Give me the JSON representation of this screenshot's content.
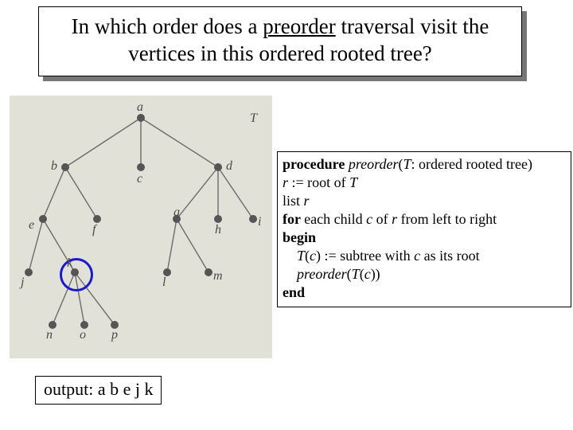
{
  "title": {
    "pre": "In which order does a ",
    "underlined": "preorder",
    "post": " traversal visit the vertices in this ordered rooted tree?"
  },
  "tree": {
    "label_T": "T",
    "nodes": {
      "a": "a",
      "b": "b",
      "c": "c",
      "d": "d",
      "e": "e",
      "f": "f",
      "g": "g",
      "h": "h",
      "i": "i",
      "j": "j",
      "k": "k",
      "l": "l",
      "m": "m",
      "n": "n",
      "o": "o",
      "p": "p"
    }
  },
  "algo": {
    "l1_b": "procedure ",
    "l1_i": "preorder",
    "l1_rest_a": "(",
    "l1_T": "T",
    "l1_rest_b": ": ordered rooted tree)",
    "l2_a": "r",
    "l2_b": " := root of ",
    "l2_c": "T",
    "l3_a": "list ",
    "l3_b": "r",
    "l4_a": "for ",
    "l4_b": "each child ",
    "l4_c": "c",
    "l4_d": " of ",
    "l4_e": "r",
    "l4_f": " from left to right",
    "l5": "begin",
    "l6_a": "T",
    "l6_b": "(",
    "l6_c": "c",
    "l6_d": ") := subtree with ",
    "l6_e": "c",
    "l6_f": " as its root",
    "l7_a": "preorder",
    "l7_b": "(",
    "l7_c": "T",
    "l7_d": "(",
    "l7_e": "c",
    "l7_f": "))",
    "l8": "end"
  },
  "output": {
    "label": "output: a b e j k"
  }
}
